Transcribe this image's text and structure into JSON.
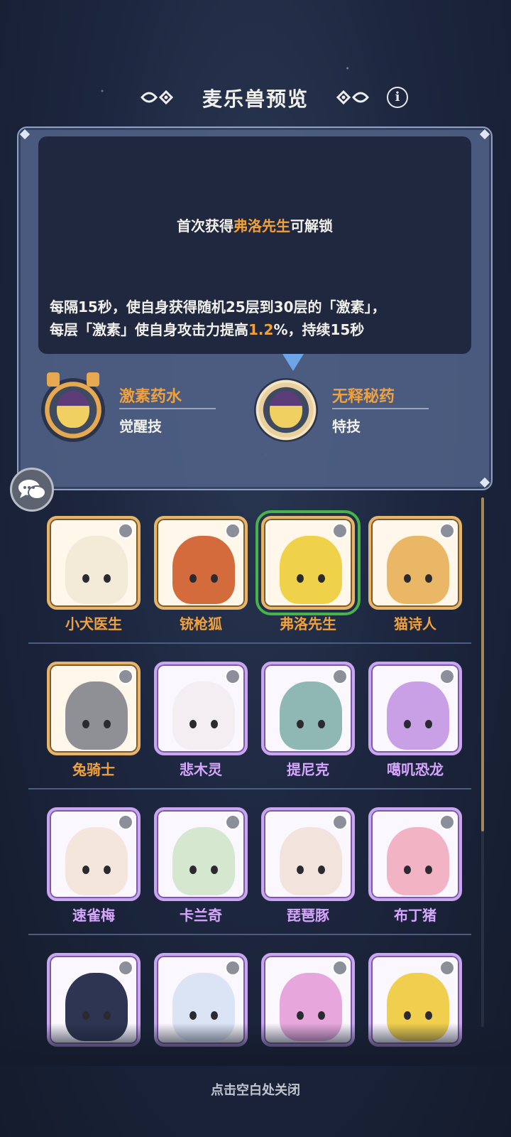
{
  "header": {
    "title": "麦乐兽预览",
    "info_icon": "info-icon",
    "info_glyph": "i"
  },
  "panel": {
    "unlock_prefix": "首次获得",
    "unlock_name": "弗洛先生",
    "unlock_suffix": "可解锁",
    "desc_line1": "每隔15秒，使自身获得随机25层到30层的「激素」，",
    "desc_line2_a": "每层「激素」使自身攻击力提高",
    "desc_line2_value": "1.2",
    "desc_line2_b": "%，持续15秒",
    "skills": [
      {
        "name": "激素药水",
        "type": "觉醒技"
      },
      {
        "name": "无释秘药",
        "type": "特技"
      }
    ]
  },
  "pals": [
    {
      "name": "小犬医生",
      "rarity": "gold",
      "color": "#f3ead8"
    },
    {
      "name": "铳枪狐",
      "rarity": "gold",
      "color": "#d46b3c"
    },
    {
      "name": "弗洛先生",
      "rarity": "gold",
      "color": "#f0d24a",
      "selected": true
    },
    {
      "name": "猫诗人",
      "rarity": "gold",
      "color": "#e9b765"
    },
    {
      "name": "兔骑士",
      "rarity": "gold",
      "color": "#8f8f96"
    },
    {
      "name": "悲木灵",
      "rarity": "purple",
      "color": "#f2eef2"
    },
    {
      "name": "提尼克",
      "rarity": "purple",
      "color": "#8fb8b5"
    },
    {
      "name": "噶叽恐龙",
      "rarity": "purple",
      "color": "#c9a0e6"
    },
    {
      "name": "速雀梅",
      "rarity": "purple",
      "color": "#f5e6dc"
    },
    {
      "name": "卡兰奇",
      "rarity": "purple",
      "color": "#d5e8cf"
    },
    {
      "name": "琵琶豚",
      "rarity": "purple",
      "color": "#f2e4dc"
    },
    {
      "name": "布丁猪",
      "rarity": "purple",
      "color": "#f2b3c4"
    },
    {
      "name": "",
      "rarity": "purple",
      "color": "#2e3552"
    },
    {
      "name": "",
      "rarity": "purple",
      "color": "#dbe4f5"
    },
    {
      "name": "",
      "rarity": "purple",
      "color": "#e7a7dc"
    },
    {
      "name": "",
      "rarity": "purple",
      "color": "#f0cf4e"
    }
  ],
  "footer": {
    "close_hint": "点击空白处关闭"
  },
  "colors": {
    "accent_gold": "#f0a13d",
    "selected_green": "#47b34a",
    "rare_purple": "#d6a6ff"
  }
}
